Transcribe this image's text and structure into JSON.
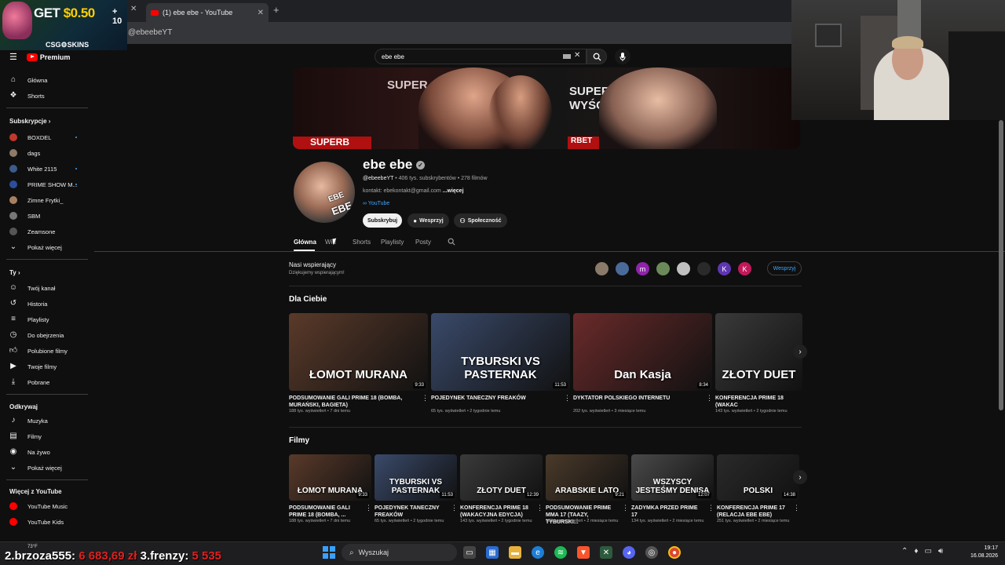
{
  "browser": {
    "tab_title": "(1) ebe ebe - YouTube",
    "url": "@ebeebeYT",
    "promo": {
      "get": "GET",
      "amount": "$0.50",
      "plus": "+ 10",
      "brand": "CSG⚙SKINS"
    }
  },
  "youtube": {
    "logo": "Premium",
    "search_value": "ebe ebe"
  },
  "sidebar": {
    "main": [
      {
        "label": "Główna",
        "icon": "home-icon"
      },
      {
        "label": "Shorts",
        "icon": "shorts-icon"
      }
    ],
    "subs_header": "Subskrypcje",
    "subs": [
      {
        "label": "BOXDEL",
        "color": "#c0392b",
        "dot": true
      },
      {
        "label": "dags",
        "color": "#8e7a6a",
        "dot": false
      },
      {
        "label": "White 2115",
        "color": "#3b5b8a",
        "dot": true
      },
      {
        "label": "PRIME SHOW M...",
        "color": "#2b4f9a",
        "dot": true
      },
      {
        "label": "Zimne Frytki_",
        "color": "#a88060",
        "dot": false
      },
      {
        "label": "SBM",
        "color": "#777777",
        "dot": false
      },
      {
        "label": "Zeamsone",
        "color": "#555555",
        "dot": false
      },
      {
        "label": "Pokaż więcej",
        "color": "",
        "dot": false
      }
    ],
    "you_header": "Ty",
    "you": [
      "Twój kanał",
      "Historia",
      "Playlisty",
      "Do obejrzenia",
      "Polubione filmy",
      "Twoje filmy",
      "Pobrane"
    ],
    "explore_header": "Odkrywaj",
    "explore": [
      "Muzyka",
      "Filmy",
      "Na żywo",
      "Pokaż więcej"
    ],
    "more_header": "Więcej z YouTube",
    "more": [
      "YouTube Music",
      "YouTube Kids"
    ]
  },
  "channel": {
    "name": "ebe ebe",
    "handle": "@ebeebeYT",
    "stats": " • 406 tys. subskrybentów • 278 filmów",
    "contact": "kontakt: ebekontakt@gmail.com",
    "more": " ...więcej",
    "link": "∞ YouTube",
    "buttons": {
      "subscribe": "Subskrybuj",
      "support": "Wesprzyj",
      "community": "Społeczność"
    },
    "banner_texts": [
      "SUPER",
      "WYŚCIG",
      "SUPERB",
      "RBET"
    ]
  },
  "tabs": [
    "Główna",
    "Wid",
    "Shorts",
    "Playlisty",
    "Posty"
  ],
  "supporters": {
    "title": "Nasi wspierający",
    "subtitle": "Dziękujemy wspierającym!",
    "button": "Wesprzyj",
    "avatars": [
      {
        "letter": "",
        "color": "#8a7a6a"
      },
      {
        "letter": "",
        "color": "#4a6a9a"
      },
      {
        "letter": "m",
        "color": "#8e24aa"
      },
      {
        "letter": "",
        "color": "#6a8a5a"
      },
      {
        "letter": "",
        "color": "#c0c0c0"
      },
      {
        "letter": "",
        "color": "#2a2a2a"
      },
      {
        "letter": "K",
        "color": "#5e35b1"
      },
      {
        "letter": "K",
        "color": "#c2185b"
      }
    ]
  },
  "for_you": {
    "title": "Dla Ciebie",
    "videos": [
      {
        "caption": "ŁOMOT MURANA",
        "duration": "9:33",
        "title": "PODSUMOWANIE GALI PRIME 18 (BOMBA, MURAŃSKI, BAGIETA)",
        "meta": "188 tys. wyświetleń • 7 dni temu",
        "bg": "#5a3a2a"
      },
      {
        "caption": "TYBURSKI VS PASTERNAK",
        "duration": "11:53",
        "title": "POJEDYNEK TANECZNY FREAKÓW",
        "meta": "65 tys. wyświetleń • 2 tygodnie temu",
        "bg": "#3a4a6a"
      },
      {
        "caption": "Dan Kasja",
        "duration": "8:34",
        "title": "DYKTATOR POLSKIEGO INTERNETU",
        "meta": "202 tys. wyświetleń • 3 miesiące temu",
        "bg": "#6a2a2a"
      },
      {
        "caption": "ZŁOTY DUET",
        "duration": "",
        "title": "KONFERENCJA PRIME 18 (WAKAC",
        "meta": "143 tys. wyświetleń • 2 tygodnie temu",
        "bg": "#3a3a3a"
      }
    ]
  },
  "films": {
    "title": "Filmy",
    "videos": [
      {
        "caption": "ŁOMOT MURANA",
        "duration": "9:33",
        "title": "PODSUMOWANIE GALI PRIME 18 (BOMBA, ...",
        "meta": "188 tys. wyświetleń • 7 dni temu",
        "bg": "#5a3a2a"
      },
      {
        "caption": "TYBURSKI VS PASTERNAK",
        "duration": "11:53",
        "title": "POJEDYNEK TANECZNY FREAKÓW",
        "meta": "65 tys. wyświetleń • 2 tygodnie temu",
        "bg": "#3a4a6a"
      },
      {
        "caption": "ZŁOTY DUET",
        "duration": "12:39",
        "title": "KONFERENCJA PRIME 18 (WAKACYJNA EDYCJA)",
        "meta": "143 tys. wyświetleń • 2 tygodnie temu",
        "bg": "#3a3a3a"
      },
      {
        "caption": "ARABSKIE LATO",
        "duration": "9:21",
        "title": "PODSUMOWANIE PRIME MMA 17 (TAAZY, TYBURSKI...",
        "meta": "188 tys. wyświetleń • 2 miesiące temu",
        "bg": "#4a3a2a"
      },
      {
        "caption": "WSZYSCY JESTEŚMY DENISA",
        "duration": "12:07",
        "title": "ZADYMKA PRZED PRIME 17",
        "meta": "134 tys. wyświetleń • 2 miesiące temu",
        "bg": "#4a4a4a"
      },
      {
        "caption": "POLSKI",
        "duration": "14:38",
        "title": "KONFERENCJA PRIME 17 (RELACJA EBE EBE)",
        "meta": "251 tys. wyświetleń • 2 miesiące temu",
        "bg": "#2a2a2a"
      }
    ]
  },
  "taskbar": {
    "search": "Wyszukaj",
    "time": "19:17",
    "date": "16.08.2026",
    "weather": "73°F"
  },
  "overlay": {
    "a_label": "2.brzoza555:",
    "a_value": "6 683,69 zł",
    "b_label": "3.frenzy:",
    "b_value": "5 535"
  }
}
